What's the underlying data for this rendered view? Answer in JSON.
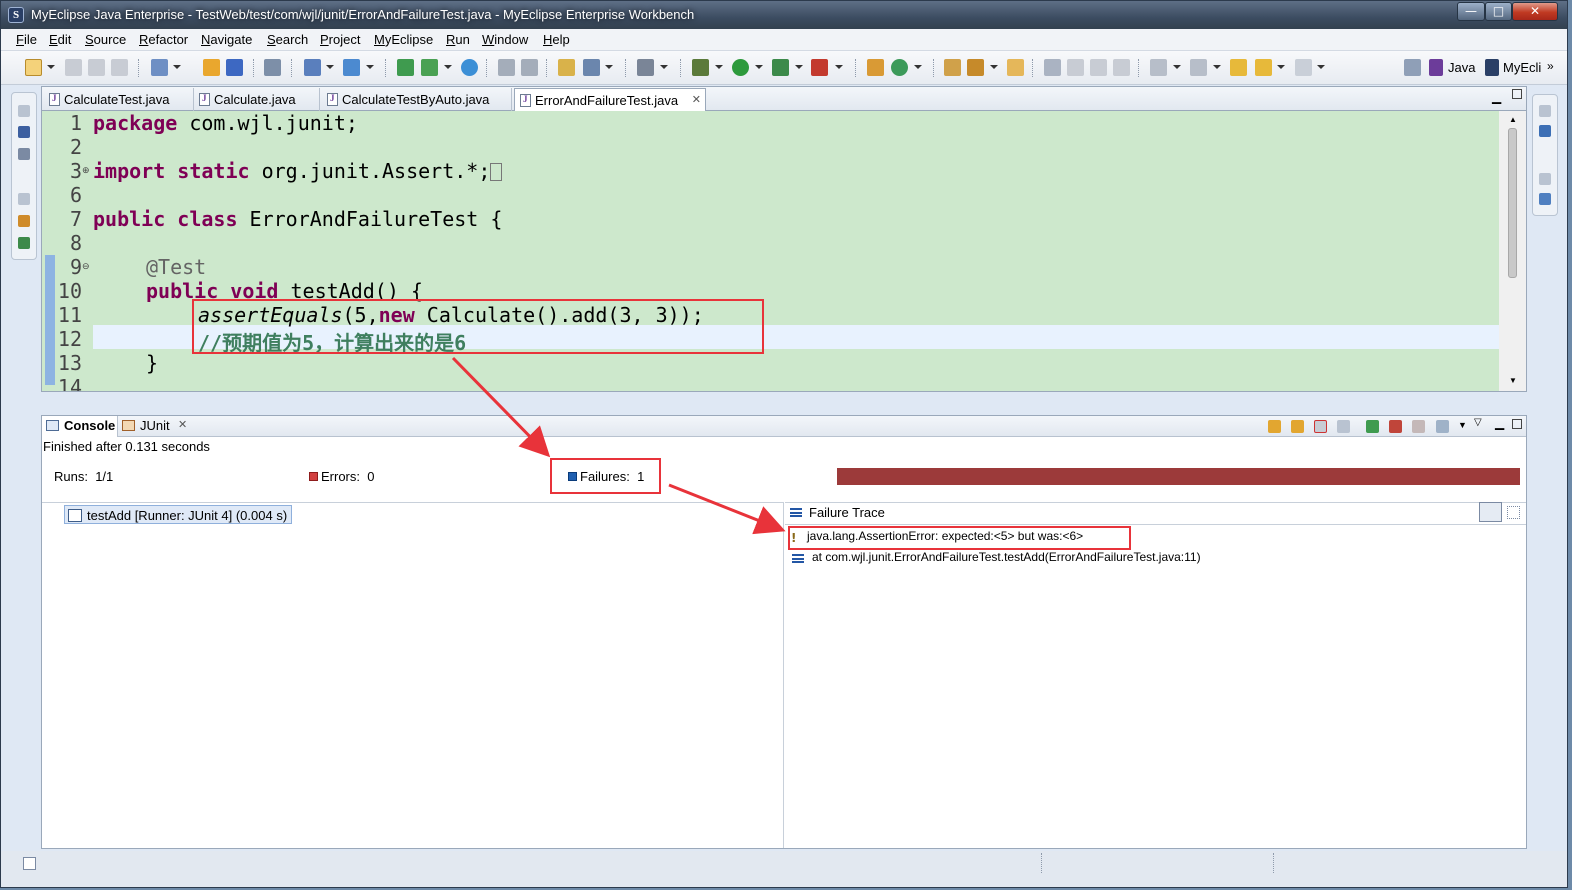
{
  "window": {
    "title": "MyEclipse Java Enterprise - TestWeb/test/com/wjl/junit/ErrorAndFailureTest.java - MyEclipse Enterprise Workbench",
    "minimize_glyph": "—",
    "maximize_glyph": "□",
    "close_glyph": "✕"
  },
  "menu": [
    "File",
    "Edit",
    "Source",
    "Refactor",
    "Navigate",
    "Search",
    "Project",
    "MyEclipse",
    "Run",
    "Window",
    "Help"
  ],
  "perspectives": [
    "Java",
    "MyEcli"
  ],
  "editor": {
    "tabs": [
      "CalculateTest.java",
      "Calculate.java",
      "CalculateTestByAuto.java",
      "ErrorAndFailureTest.java"
    ],
    "active_tab": 3,
    "line_numbers": [
      "1",
      "2",
      "3",
      "6",
      "7",
      "8",
      "9",
      "10",
      "11",
      "12",
      "13",
      "14"
    ],
    "code": {
      "l1_kw": "package",
      "l1_rest": " com.wjl.junit;",
      "l3_kw1": "import",
      "l3_kw2": "static",
      "l3_rest": " org.junit.Assert.*;",
      "l7_kw1": "public",
      "l7_kw2": "class",
      "l7_rest": " ErrorAndFailureTest {",
      "l9_anno": "@Test",
      "l10_kw1": "public",
      "l10_kw2": "void",
      "l10_rest": " testAdd() {",
      "l11_method": "assertEquals",
      "l11_a": "(5,",
      "l11_kw": "new",
      "l11_b": " Calculate().add(3, 3));",
      "l12_comment": "//预期值为5，计算出来的是6",
      "l13": "}"
    }
  },
  "junit_view": {
    "tabs": [
      "Console",
      "JUnit"
    ],
    "status": "Finished after 0.131 seconds",
    "runs_label": "Runs:",
    "runs_value": "1/1",
    "errors_label": "Errors:",
    "errors_value": "0",
    "failures_label": "Failures:",
    "failures_value": "1",
    "progress_color": "#9c3a3a",
    "progress_fraction": 1.0,
    "test_item": "testAdd [Runner: JUnit 4] (0.004 s)",
    "failure_trace_label": "Failure Trace",
    "trace_lines": [
      "java.lang.AssertionError: expected:<5> but was:<6>",
      "at com.wjl.junit.ErrorAndFailureTest.testAdd(ErrorAndFailureTest.java:11)"
    ]
  },
  "colors": {
    "code_background": "#cde8cc",
    "keyword": "#7f0055",
    "comment": "#3f7f5f",
    "highlight_box": "#e8333a"
  }
}
